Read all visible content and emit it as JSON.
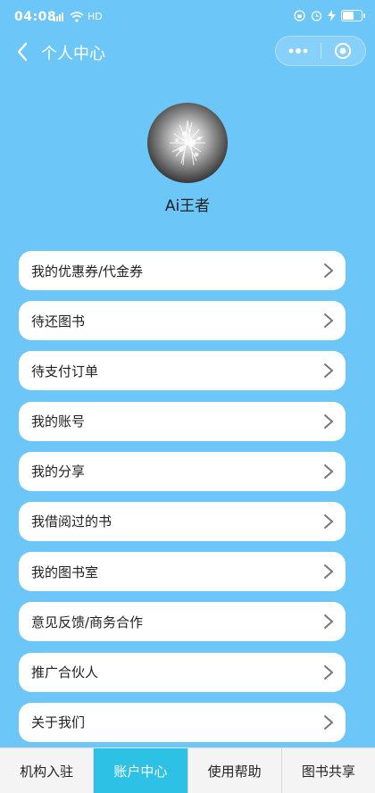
{
  "status_bar": {
    "time": "04:08",
    "network": "HD",
    "battery_level": 0.55
  },
  "navbar": {
    "title": "个人中心",
    "more_icon": "ellipsis-icon",
    "close_icon": "target-circle-icon"
  },
  "profile": {
    "username": "Ai王者"
  },
  "menu": [
    {
      "label": "我的优惠券/代金券"
    },
    {
      "label": "待还图书"
    },
    {
      "label": "待支付订单"
    },
    {
      "label": "我的账号"
    },
    {
      "label": "我的分享"
    },
    {
      "label": "我借阅过的书"
    },
    {
      "label": "我的图书室"
    },
    {
      "label": "意见反馈/商务合作"
    },
    {
      "label": "推广合伙人"
    },
    {
      "label": "关于我们"
    }
  ],
  "tabbar": {
    "tabs": [
      {
        "label": "机构入驻",
        "active": false
      },
      {
        "label": "账户中心",
        "active": true
      },
      {
        "label": "使用帮助",
        "active": false
      },
      {
        "label": "图书共享",
        "active": false
      }
    ]
  },
  "colors": {
    "background": "#6cc6f8",
    "tab_active": "#2ec1e6"
  }
}
